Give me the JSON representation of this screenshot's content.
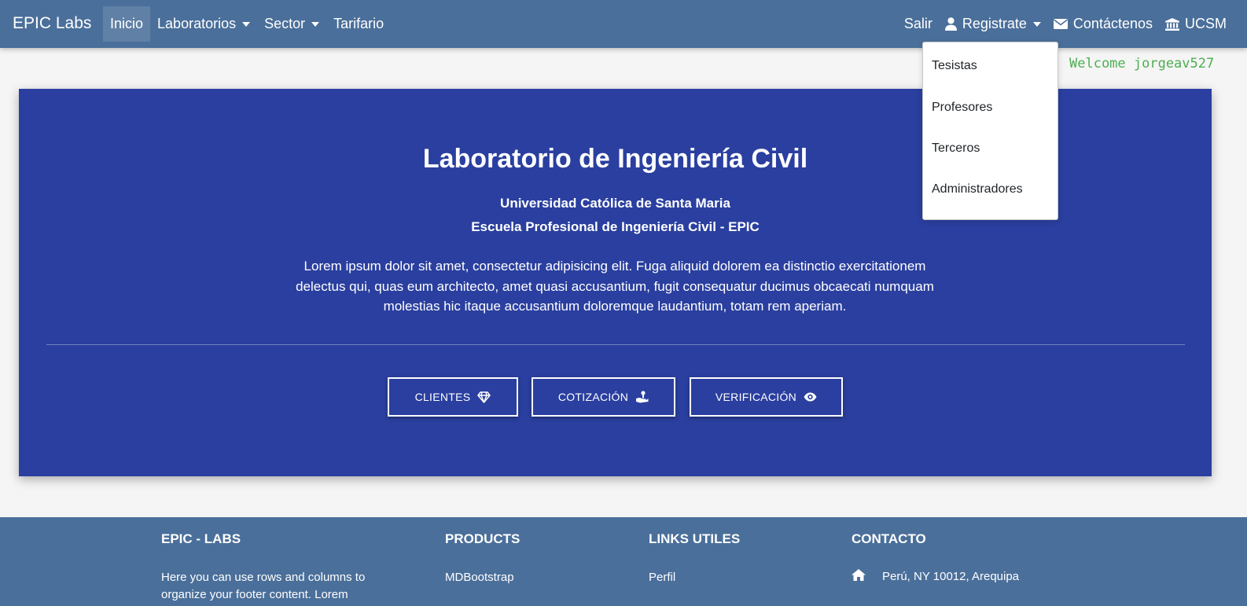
{
  "navbar": {
    "brand": "EPIC Labs",
    "left_items": [
      {
        "label": "Inicio"
      },
      {
        "label": "Laboratorios"
      },
      {
        "label": "Sector"
      },
      {
        "label": "Tarifario"
      }
    ],
    "right_items": [
      {
        "label": "Salir"
      },
      {
        "label": "Registrate",
        "icon": "user-icon"
      },
      {
        "label": "Contáctenos",
        "icon": "envelope-icon"
      },
      {
        "label": "UCSM",
        "icon": "university-icon"
      }
    ],
    "background_color": "#4a6f9a"
  },
  "dropdown": {
    "items": [
      {
        "label": "Tesistas"
      },
      {
        "label": "Profesores"
      },
      {
        "label": "Terceros"
      },
      {
        "label": "Administradores"
      }
    ]
  },
  "welcome": "Welcome jorgeav527",
  "hero": {
    "title": "Laboratorio de Ingeniería Civil",
    "subtitle1": "Universidad Católica de Santa Maria",
    "subtitle2": "Escuela Profesional de Ingeniería Civil - EPIC",
    "description": "Lorem ipsum dolor sit amet, consectetur adipisicing elit. Fuga aliquid dolorem ea distinctio exercitationem delectus qui, quas eum architecto, amet quasi accusantium, fugit consequatur ducimus obcaecati numquam molestias hic itaque accusantium doloremque laudantium, totam rem aperiam.",
    "buttons": [
      {
        "label": "CLIENTES",
        "icon": "diamond-icon"
      },
      {
        "label": "COTIZACIÓN",
        "icon": "hand-holding-icon"
      },
      {
        "label": "VERIFICACIÓN",
        "icon": "eye-icon"
      }
    ],
    "background_color": "#2a3f9f"
  },
  "footer": {
    "col1": {
      "heading": "EPIC - LABS",
      "text_line1": "Here you can use rows and columns to",
      "text_line2": "organize your footer content. Lorem"
    },
    "col2": {
      "heading": "PRODUCTS",
      "item1": "MDBootstrap"
    },
    "col3": {
      "heading": "LINKS UTILES",
      "item1": "Perfil"
    },
    "col4": {
      "heading": "CONTACTO",
      "item1": "Perú, NY 10012, Arequipa",
      "item1_icon": "home-icon"
    }
  }
}
